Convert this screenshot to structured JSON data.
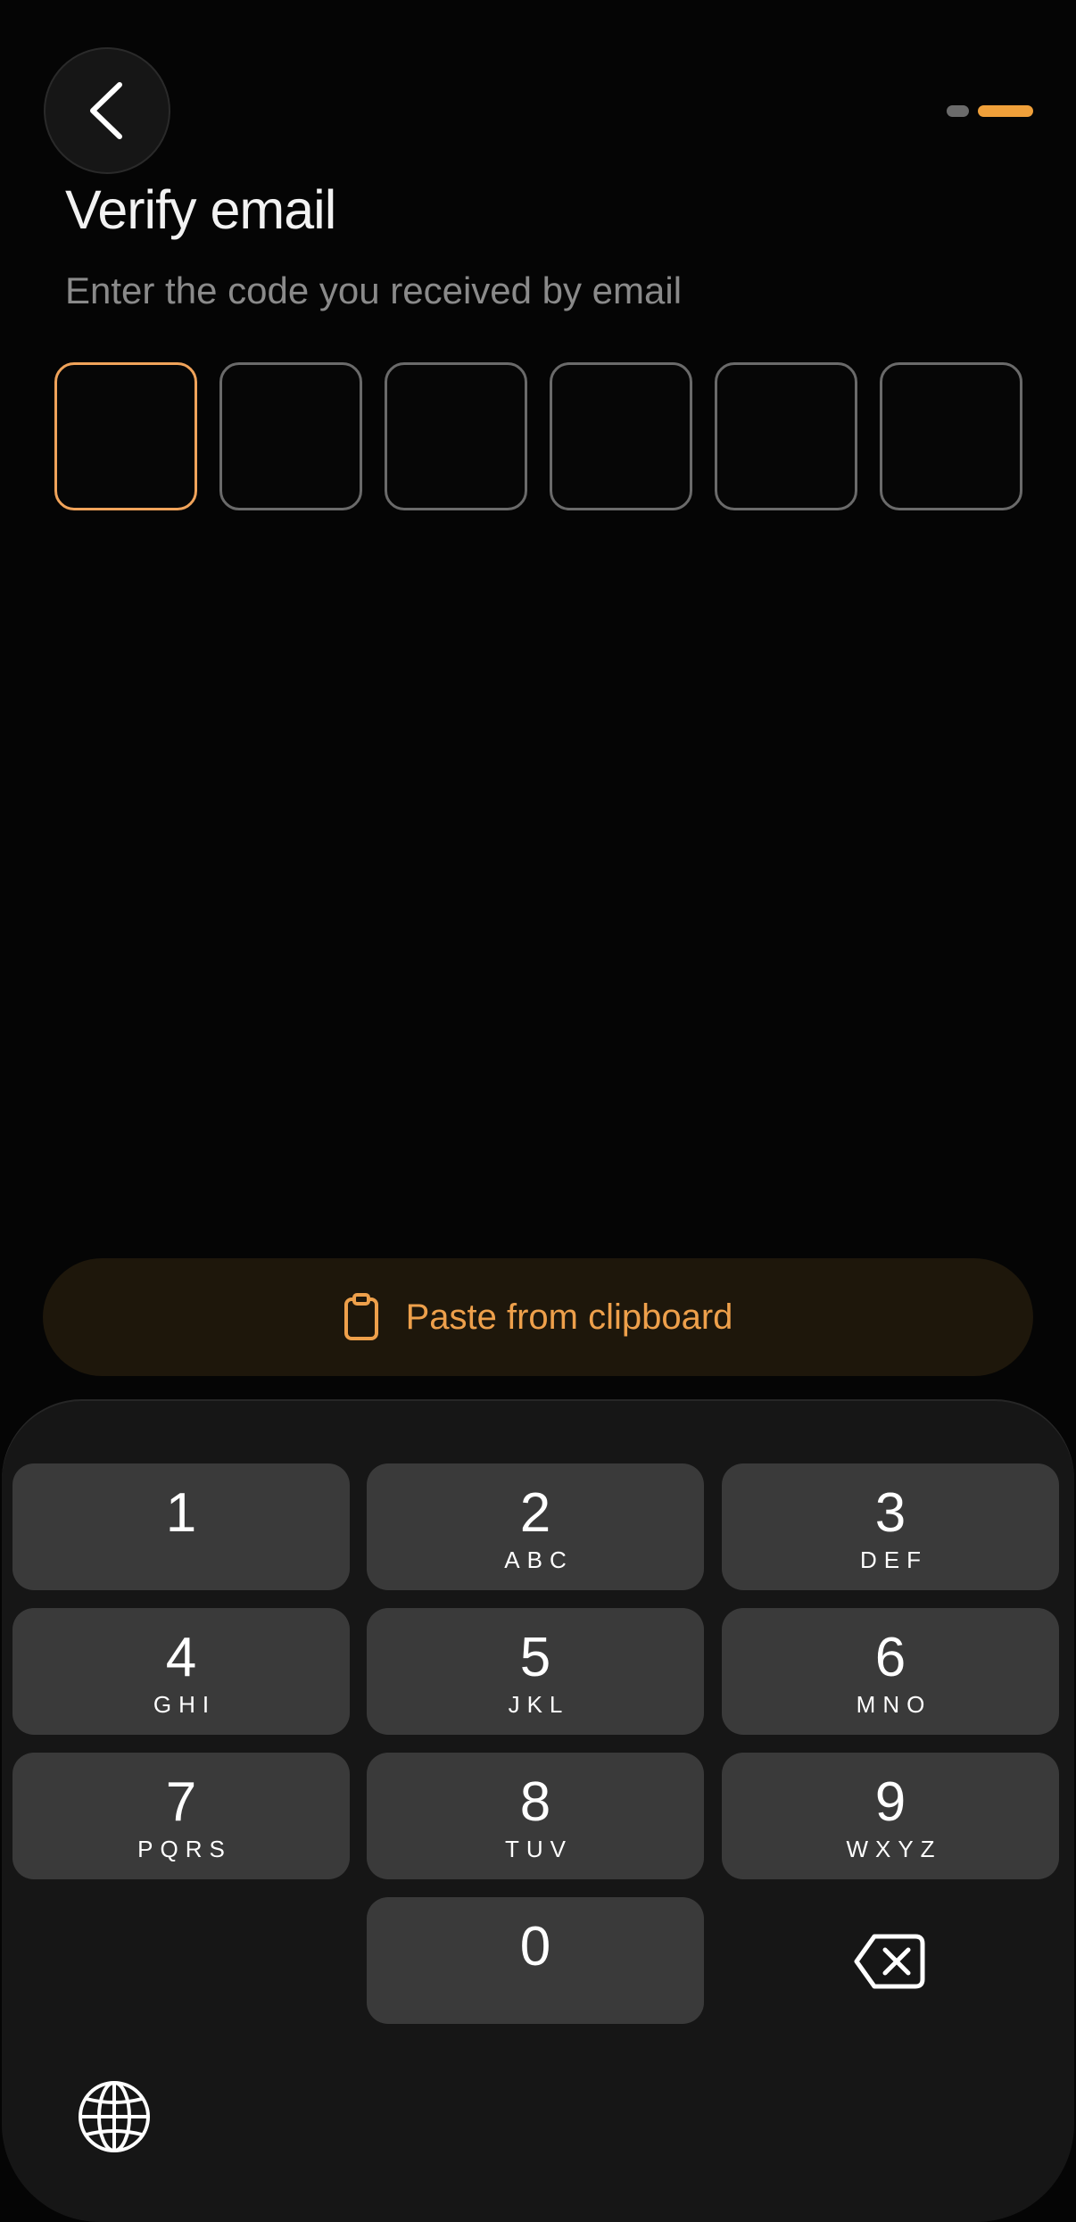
{
  "header": {
    "back_icon": "chevron-left-icon",
    "progress": {
      "total_steps": 2,
      "current_step": 2
    }
  },
  "title": "Verify email",
  "subtitle": "Enter the code you received by email",
  "code": {
    "length": 6,
    "digits": [
      "",
      "",
      "",
      "",
      "",
      ""
    ],
    "active_index": 0
  },
  "paste_button": {
    "icon": "clipboard-icon",
    "label": "Paste from clipboard"
  },
  "keyboard": {
    "keys": [
      {
        "digit": "1",
        "letters": ""
      },
      {
        "digit": "2",
        "letters": "ABC"
      },
      {
        "digit": "3",
        "letters": "DEF"
      },
      {
        "digit": "4",
        "letters": "GHI"
      },
      {
        "digit": "5",
        "letters": "JKL"
      },
      {
        "digit": "6",
        "letters": "MNO"
      },
      {
        "digit": "7",
        "letters": "PQRS"
      },
      {
        "digit": "8",
        "letters": "TUV"
      },
      {
        "digit": "9",
        "letters": "WXYZ"
      },
      {
        "digit": "0",
        "letters": ""
      }
    ],
    "backspace_icon": "backspace-icon",
    "globe_icon": "globe-icon"
  },
  "colors": {
    "accent": "#f0a03a",
    "background": "#050505",
    "key_background": "#3a3a3a",
    "keyboard_background": "#161616"
  }
}
